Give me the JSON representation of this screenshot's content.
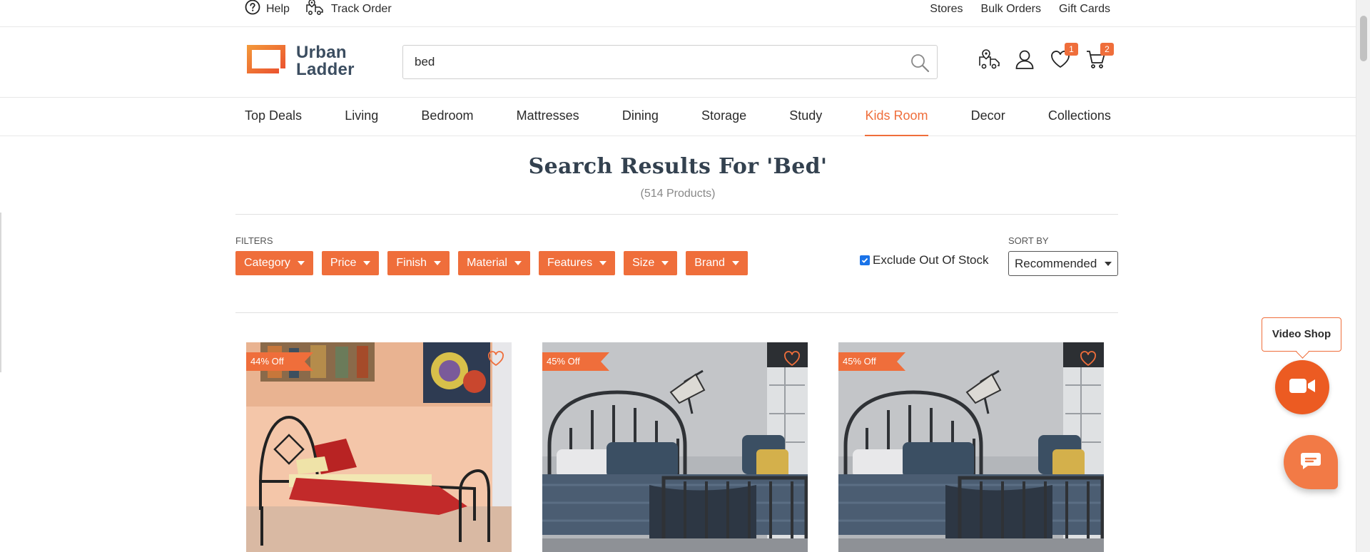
{
  "topbar": {
    "help_label": "Help",
    "track_order_label": "Track Order",
    "links": [
      "Stores",
      "Bulk Orders",
      "Gift Cards"
    ]
  },
  "header": {
    "logo_line1": "Urban",
    "logo_line2": "Ladder",
    "search_value": "bed",
    "wishlist_count": "1",
    "cart_count": "2"
  },
  "nav": {
    "items": [
      "Top Deals",
      "Living",
      "Bedroom",
      "Mattresses",
      "Dining",
      "Storage",
      "Study",
      "Kids Room",
      "Decor",
      "Collections"
    ],
    "active": "Kids Room"
  },
  "results": {
    "title": "Search Results For 'Bed'",
    "count": "(514 Products)"
  },
  "filters": {
    "label": "FILTERS",
    "chips": [
      "Category",
      "Price",
      "Finish",
      "Material",
      "Features",
      "Size",
      "Brand"
    ],
    "exclude_out_of_stock_label": "Exclude Out Of Stock",
    "exclude_out_of_stock_checked": true
  },
  "sort": {
    "label": "SORT BY",
    "selected": "Recommended"
  },
  "products": [
    {
      "discount": "44% Off",
      "image": "red-single-bed-photo"
    },
    {
      "discount": "45% Off",
      "image": "grey-metal-bed-photo"
    },
    {
      "discount": "45% Off",
      "image": "grey-metal-bed-photo"
    }
  ],
  "floating": {
    "video_shop_label": "Video Shop"
  },
  "colors": {
    "accent": "#ef6e3b",
    "title": "#33414f",
    "logo_text": "#3b4d60"
  }
}
